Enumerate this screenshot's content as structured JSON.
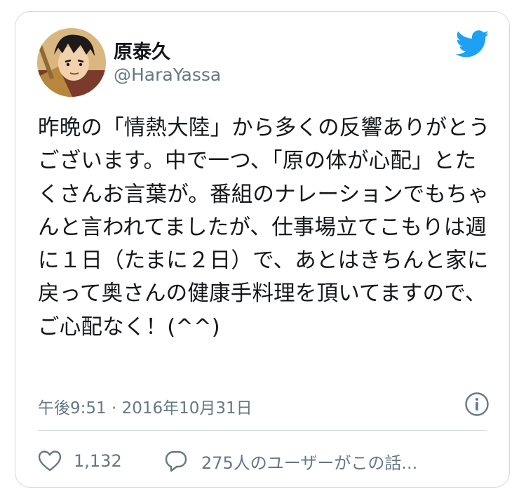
{
  "user": {
    "display_name": "原泰久",
    "handle": "@HaraYassa"
  },
  "tweet": {
    "text": "昨晩の「情熱大陸」から多くの反響ありがとうございます。中で一つ、「原の体が心配」とたくさんお言葉が。番組のナレーションでもちゃんと言われてましたが、仕事場立てこもりは週に１日（たまに２日）で、あとはきちんと家に戻って奥さんの健康手料理を頂いてますので、ご心配なく！(^^)",
    "timestamp": "午後9:51 · 2016年10月31日"
  },
  "actions": {
    "like_count": "1,132",
    "reply_label": "275人のユーザーがこの話..."
  },
  "icons": {
    "logo": "twitter-bird-icon",
    "info": "info-icon",
    "like": "heart-icon",
    "reply": "speech-bubble-icon"
  },
  "colors": {
    "brand": "#1da1f2",
    "text": "#14171a",
    "secondary": "#657786",
    "border": "#cfd9de"
  }
}
